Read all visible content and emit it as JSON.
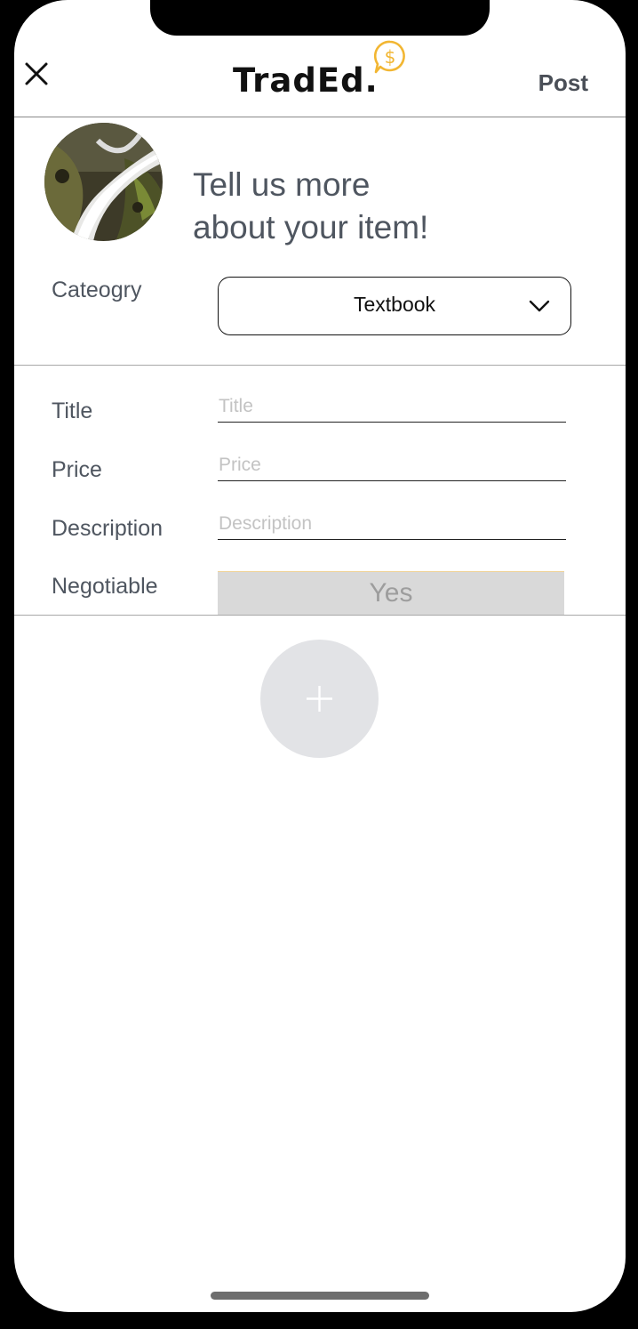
{
  "header": {
    "logo_text": "TradEd.",
    "logo_icon": "dollar-speech-bubble-icon",
    "close_icon": "close-icon",
    "post_label": "Post"
  },
  "intro": {
    "title_line1": "Tell us more",
    "title_line2": "about your item!"
  },
  "category": {
    "label": "Cateogry",
    "selected": "Textbook",
    "icon": "chevron-down-icon"
  },
  "form": {
    "title_label": "Title",
    "title_placeholder": "Title",
    "price_label": "Price",
    "price_placeholder": "Price",
    "description_label": "Description",
    "description_placeholder": "Description",
    "negotiable_label": "Negotiable",
    "negotiable_value": "Yes"
  },
  "add_photo": {
    "icon": "plus-icon"
  },
  "colors": {
    "accent": "#f2b632",
    "text_muted": "#4f5660",
    "toggle_bg": "#d9d9d9",
    "add_bg": "#e2e3e6"
  }
}
